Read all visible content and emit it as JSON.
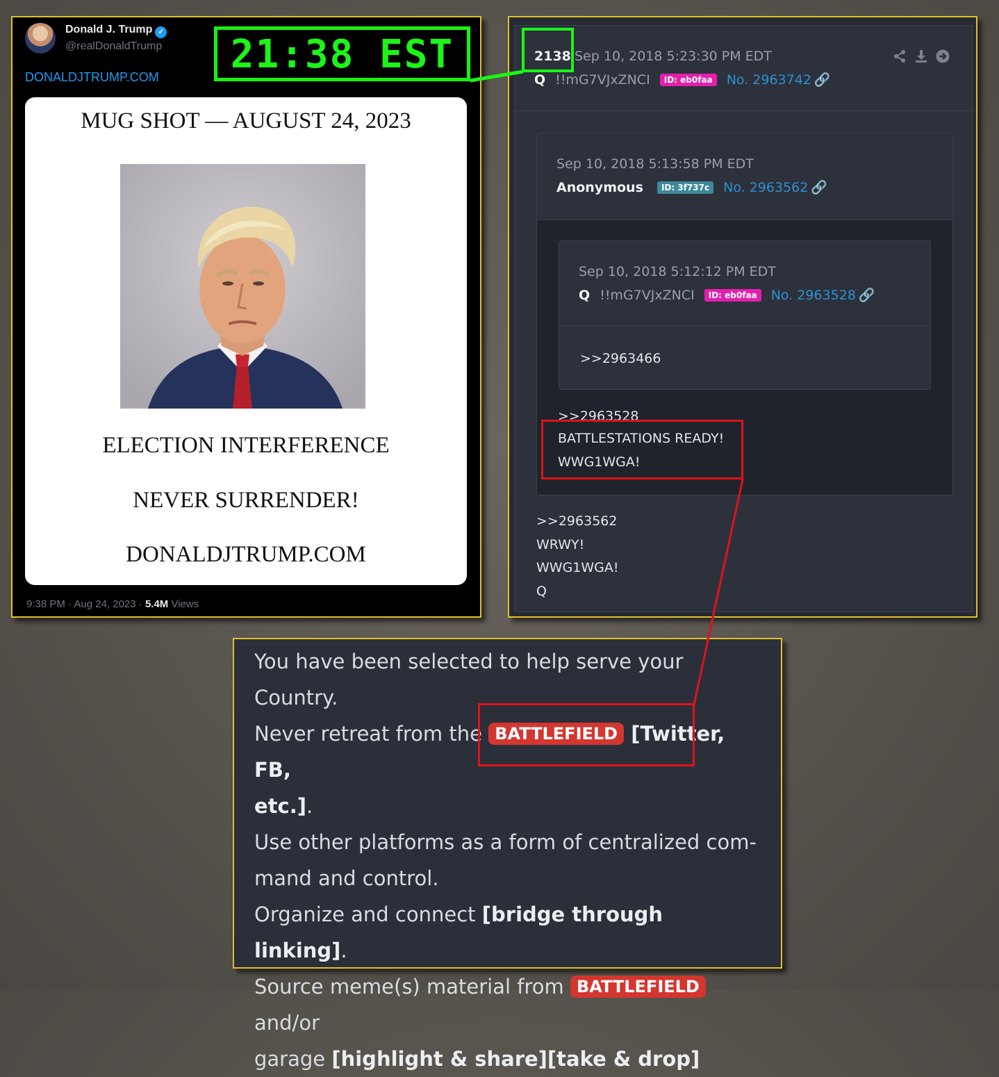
{
  "tweet": {
    "author_name": "Donald J. Trump",
    "handle": "@realDonaldTrump",
    "link_text": "DONALDJTRUMP.COM",
    "card": {
      "title": "MUG SHOT — AUGUST 24, 2023",
      "line1": "ELECTION INTERFERENCE",
      "line2": "NEVER SURRENDER!",
      "line3": "DONALDJTRUMP.COM"
    },
    "timestamp": "9:38 PM · Aug 24, 2023 · ",
    "views_count": "5.4M",
    "views_label": " Views"
  },
  "annotation": {
    "time_label": "21:38 EST"
  },
  "q_post": {
    "number": "2138",
    "timestamp": "Sep 10, 2018 5:23:30 PM EDT",
    "author": "Q",
    "tripcode": "!!mG7VJxZNCI",
    "id_tag": "ID: eb0faa",
    "post_no": "No. 2963742",
    "icons": [
      "share-icon",
      "download-icon",
      "arrow-right-circle-icon",
      "link-icon"
    ],
    "colors": {
      "id_pink": "#e41fae",
      "id_teal": "#3e8a9a",
      "link_blue": "#2f8fd3"
    },
    "reply1": {
      "timestamp": "Sep 10, 2018 5:13:58 PM EDT",
      "author": "Anonymous",
      "id_tag": "ID: 3f737c",
      "post_no": "No. 2963562",
      "reply2": {
        "timestamp": "Sep 10, 2018 5:12:12 PM EDT",
        "author": "Q",
        "tripcode": "!!mG7VJxZNCI",
        "id_tag": "ID: eb0faa",
        "post_no": "No. 2963528",
        "body": ">>2963466"
      },
      "body_ref": ">>2963528",
      "body_line1": "BATTLESTATIONS READY!",
      "body_line2": "WWG1WGA!"
    },
    "body_ref": ">>2963562",
    "body_line1": "WRWY!",
    "body_line2": "WWG1WGA!",
    "body_sign": "Q"
  },
  "bottom": {
    "l1": "You have been selected to help serve your",
    "l2": "Country.",
    "l3a": "Never retreat from the ",
    "pill1": "BATTLEFIELD",
    "l3b": " [Twitter, FB,",
    "l4a": "etc.]",
    "l4b": ".",
    "l5": "Use other platforms as a form of centralized com-",
    "l6": "mand and control.",
    "l7a": "Organize and connect ",
    "l7b": "[bridge through linking]",
    "l7c": ".",
    "l8a": "Source meme(s) material from ",
    "pill2": "BATTLEFIELD",
    "l8b": " and/or",
    "l9a": "garage ",
    "l9b": "[highlight & share][take & drop]"
  }
}
